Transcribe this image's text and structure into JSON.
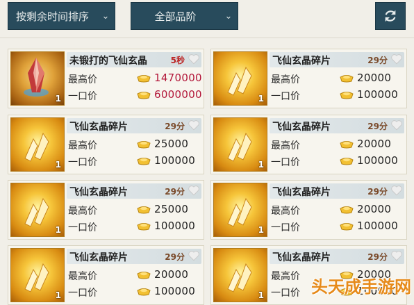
{
  "filters": {
    "sort_label": "按剩余时间排序",
    "grade_label": "全部品阶"
  },
  "listing_rows": {
    "max_price_label": "最高价",
    "buyout_label": "一口价"
  },
  "items": [
    {
      "name": "未锻打的飞仙玄晶",
      "time": "5秒",
      "qty": "1",
      "max_price": "1470000",
      "buyout": "6000000",
      "icon": "crystal-icon",
      "urgent": true
    },
    {
      "name": "飞仙玄晶碎片",
      "time": "29分",
      "qty": "1",
      "max_price": "20000",
      "buyout": "100000",
      "icon": "shard-icon",
      "urgent": false
    },
    {
      "name": "飞仙玄晶碎片",
      "time": "29分",
      "qty": "1",
      "max_price": "25000",
      "buyout": "100000",
      "icon": "shard-icon",
      "urgent": false
    },
    {
      "name": "飞仙玄晶碎片",
      "time": "29分",
      "qty": "1",
      "max_price": "20000",
      "buyout": "100000",
      "icon": "shard-icon",
      "urgent": false
    },
    {
      "name": "飞仙玄晶碎片",
      "time": "29分",
      "qty": "1",
      "max_price": "25000",
      "buyout": "100000",
      "icon": "shard-icon",
      "urgent": false
    },
    {
      "name": "飞仙玄晶碎片",
      "time": "29分",
      "qty": "1",
      "max_price": "20000",
      "buyout": "100000",
      "icon": "shard-icon",
      "urgent": false
    },
    {
      "name": "飞仙玄晶碎片",
      "time": "29分",
      "qty": "1",
      "max_price": "20000",
      "buyout": "100000",
      "icon": "shard-icon",
      "urgent": false
    },
    {
      "name": "飞仙玄晶碎片",
      "time": "29分",
      "qty": "1",
      "max_price": "20000",
      "buyout": "100000",
      "icon": "shard-icon",
      "urgent": false
    }
  ],
  "watermark": "头天成手游网",
  "colors": {
    "bar": "#284b5c",
    "price_red": "#b3173a",
    "time_red": "#b22222"
  }
}
